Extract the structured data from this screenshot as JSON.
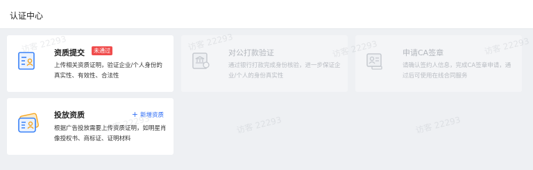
{
  "header": {
    "title": "认证中心"
  },
  "cards": [
    {
      "title": "资质提交",
      "badge": "未通过",
      "desc": "上传相关资质证明，验证企业/个人身份的真实性、有效性、合法性"
    },
    {
      "title": "对公打款验证",
      "desc": "通过银行打款完成身份核验，进一步保证企业/个人的身份真实性"
    },
    {
      "title": "申请CA签章",
      "desc": "请确认签约人信息，完成CA签章申请，通过后可使用在线合同服务"
    },
    {
      "title": "投放资质",
      "add_label": "新增资质",
      "desc": "根据广告投放需要上传资质证明，如明星肖像授权书、商标证、证明材料"
    }
  ],
  "watermark": "访客 22293",
  "colors": {
    "accent": "#2d6cf5",
    "badge": "#f04d4d",
    "icon_blue": "#3a82f7",
    "icon_orange": "#f5a623"
  }
}
